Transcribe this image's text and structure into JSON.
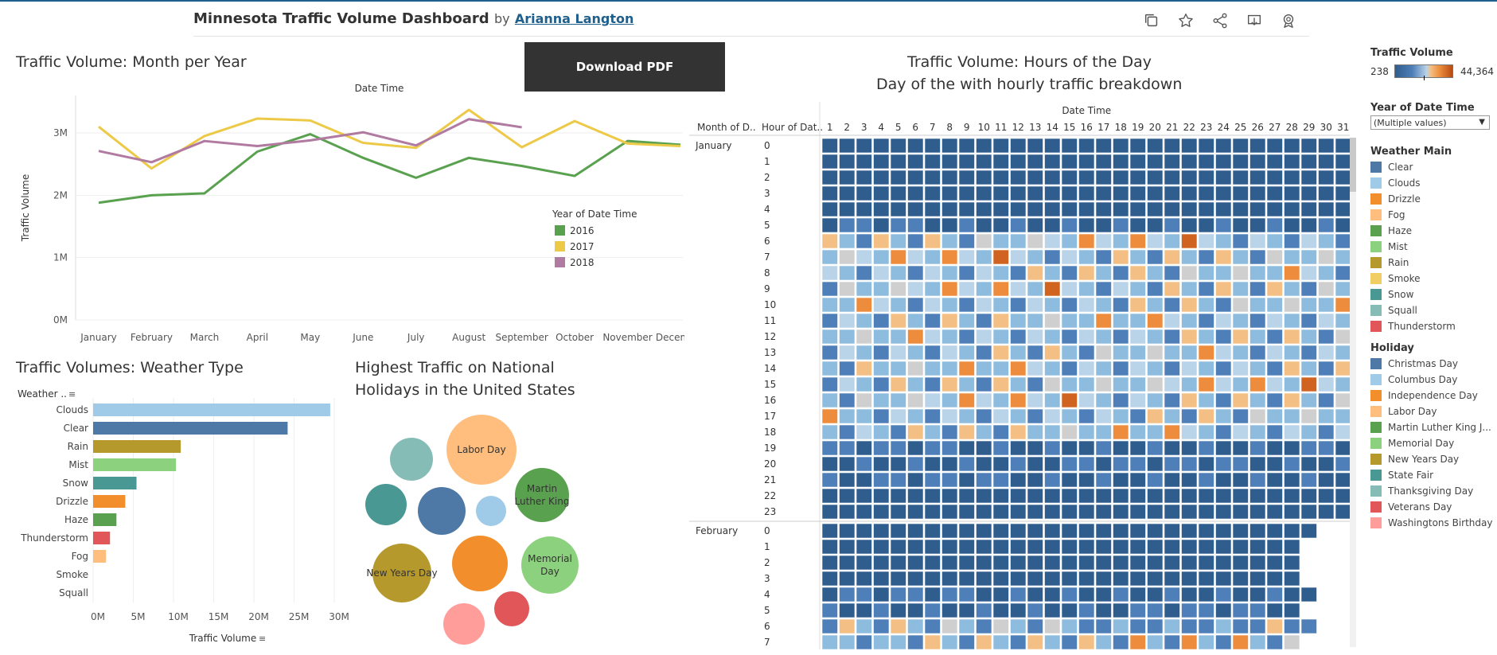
{
  "header": {
    "title": "Minnesota Traffic Volume Dashboard",
    "by": "by",
    "author": "Arianna Langton",
    "toolbar_icons": [
      "duplicate-icon",
      "star-icon",
      "share-icon",
      "download-icon",
      "badge-icon"
    ]
  },
  "download_button": {
    "label": "Download PDF"
  },
  "line_section": {
    "title": "Traffic Volume: Month per Year",
    "legend_title": "Year of Date Time"
  },
  "weather_section": {
    "title": "Traffic Volumes: Weather Type"
  },
  "holiday_section": {
    "title_line1": "Highest Traffic on National",
    "title_line2": "Holidays in the United States"
  },
  "heatmap_section": {
    "title_line1": "Traffic Volume: Hours of the Day",
    "title_line2": "Day of the with hourly traffic breakdown",
    "column_header": "Date Time",
    "row_header_month": "Month of D..",
    "row_header_hour": "Hour of Dat..",
    "months": [
      "January",
      "February"
    ],
    "days": [
      "1",
      "2",
      "3",
      "4",
      "5",
      "6",
      "7",
      "8",
      "9",
      "10",
      "11",
      "12",
      "13",
      "14",
      "15",
      "16",
      "17",
      "18",
      "19",
      "20",
      "21",
      "22",
      "23",
      "24",
      "25",
      "26",
      "27",
      "28",
      "29",
      "30",
      "31"
    ],
    "hours_january": [
      "0",
      "1",
      "2",
      "3",
      "4",
      "5",
      "6",
      "7",
      "8",
      "9",
      "10",
      "11",
      "12",
      "13",
      "14",
      "15",
      "16",
      "17",
      "18",
      "19",
      "20",
      "21",
      "22",
      "23"
    ],
    "hours_february": [
      "0",
      "1",
      "2",
      "3",
      "4",
      "5",
      "6",
      "7"
    ],
    "palette": {
      "dark": "#2f5d8e",
      "mid": "#4e7fb8",
      "light": "#8ebcde",
      "pale": "#b9d3e8",
      "grey": "#cfcfcf",
      "peach": "#f4bf84",
      "orange": "#ec8c3c",
      "dark_orange": "#d0631f"
    }
  },
  "legend": {
    "traffic_volume_title": "Traffic Volume",
    "traffic_min": "238",
    "traffic_max": "44,364",
    "year_filter_title": "Year of Date Time",
    "year_filter_value": "(Multiple values)",
    "weather_title": "Weather Main",
    "weather": [
      {
        "label": "Clear",
        "color": "#4e79a7"
      },
      {
        "label": "Clouds",
        "color": "#a0cbe8"
      },
      {
        "label": "Drizzle",
        "color": "#f28e2b"
      },
      {
        "label": "Fog",
        "color": "#ffbe7d"
      },
      {
        "label": "Haze",
        "color": "#59a14f"
      },
      {
        "label": "Mist",
        "color": "#8cd17d"
      },
      {
        "label": "Rain",
        "color": "#b6992d"
      },
      {
        "label": "Smoke",
        "color": "#f1ce63"
      },
      {
        "label": "Snow",
        "color": "#499894"
      },
      {
        "label": "Squall",
        "color": "#86bcb6"
      },
      {
        "label": "Thunderstorm",
        "color": "#e15759"
      }
    ],
    "holiday_title": "Holiday",
    "holidays": [
      {
        "label": "Christmas Day",
        "color": "#4e79a7"
      },
      {
        "label": "Columbus Day",
        "color": "#a0cbe8"
      },
      {
        "label": "Independence Day",
        "color": "#f28e2b"
      },
      {
        "label": "Labor Day",
        "color": "#ffbe7d"
      },
      {
        "label": "Martin Luther King J...",
        "color": "#59a14f"
      },
      {
        "label": "Memorial Day",
        "color": "#8cd17d"
      },
      {
        "label": "New Years Day",
        "color": "#b6992d"
      },
      {
        "label": "State Fair",
        "color": "#499894"
      },
      {
        "label": "Thanksgiving Day",
        "color": "#86bcb6"
      },
      {
        "label": "Veterans Day",
        "color": "#e15759"
      },
      {
        "label": "Washingtons Birthday",
        "color": "#ff9d9a"
      }
    ]
  },
  "chart_data": [
    {
      "type": "line",
      "title": "Traffic Volume: Month per Year",
      "xlabel": "Date Time",
      "ylabel": "Traffic Volume",
      "categories": [
        "January",
        "February",
        "March",
        "April",
        "May",
        "June",
        "July",
        "August",
        "September",
        "October",
        "November",
        "December"
      ],
      "y_ticks": [
        "0M",
        "1M",
        "2M",
        "3M"
      ],
      "ylim": [
        0,
        3600000
      ],
      "legend_placement": "right",
      "series": [
        {
          "name": "2016",
          "color": "#59a14f",
          "values": [
            1880000,
            2000000,
            2030000,
            2700000,
            2980000,
            2600000,
            2280000,
            2600000,
            2470000,
            2310000,
            2870000,
            2810000
          ]
        },
        {
          "name": "2017",
          "color": "#edc948",
          "values": [
            3100000,
            2430000,
            2950000,
            3230000,
            3200000,
            2840000,
            2760000,
            3370000,
            2770000,
            3190000,
            2830000,
            2790000
          ]
        },
        {
          "name": "2018",
          "color": "#b07aa1",
          "values": [
            2710000,
            2530000,
            2870000,
            2790000,
            2880000,
            3010000,
            2800000,
            3220000,
            3090000,
            null,
            null,
            null
          ]
        }
      ]
    },
    {
      "type": "bar",
      "orientation": "horizontal",
      "title": "Traffic Volumes: Weather Type",
      "xlabel": "Traffic Volume",
      "ylabel": "Weather ..",
      "x_ticks": [
        "0M",
        "5M",
        "10M",
        "15M",
        "20M",
        "25M",
        "30M"
      ],
      "xlim": [
        0,
        30000000
      ],
      "categories": [
        "Clouds",
        "Clear",
        "Rain",
        "Mist",
        "Snow",
        "Drizzle",
        "Haze",
        "Thunderstorm",
        "Fog",
        "Smoke",
        "Squall"
      ],
      "values": [
        29500000,
        24200000,
        10900000,
        10300000,
        5400000,
        4000000,
        2900000,
        2100000,
        1600000,
        0,
        0
      ],
      "colors": [
        "#a0cbe8",
        "#4e79a7",
        "#b6992d",
        "#8cd17d",
        "#499894",
        "#f28e2b",
        "#59a14f",
        "#e15759",
        "#ffbe7d",
        "#f1ce63",
        "#86bcb6"
      ]
    },
    {
      "type": "bubble",
      "title": "Highest Traffic on National Holidays in the United States",
      "bubbles": [
        {
          "label": "Labor Day",
          "holiday": "Labor Day",
          "color": "#ffbe7d",
          "size": 44
        },
        {
          "label": "Martin Luther King",
          "holiday": "Martin Luther King J...",
          "color": "#59a14f",
          "size": 34
        },
        {
          "label": "Memorial Day",
          "holiday": "Memorial Day",
          "color": "#8cd17d",
          "size": 36
        },
        {
          "label": "New Years Day",
          "holiday": "New Years Day",
          "color": "#b6992d",
          "size": 37
        },
        {
          "label": "",
          "holiday": "Thanksgiving Day",
          "color": "#86bcb6",
          "size": 27
        },
        {
          "label": "",
          "holiday": "State Fair",
          "color": "#499894",
          "size": 26
        },
        {
          "label": "",
          "holiday": "Christmas Day",
          "color": "#4e79a7",
          "size": 30
        },
        {
          "label": "",
          "holiday": "Columbus Day",
          "color": "#a0cbe8",
          "size": 19
        },
        {
          "label": "",
          "holiday": "Independence Day",
          "color": "#f28e2b",
          "size": 35
        },
        {
          "label": "",
          "holiday": "Washingtons Birthday",
          "color": "#ff9d9a",
          "size": 26
        },
        {
          "label": "",
          "holiday": "Veterans Day",
          "color": "#e15759",
          "size": 22
        }
      ]
    }
  ]
}
